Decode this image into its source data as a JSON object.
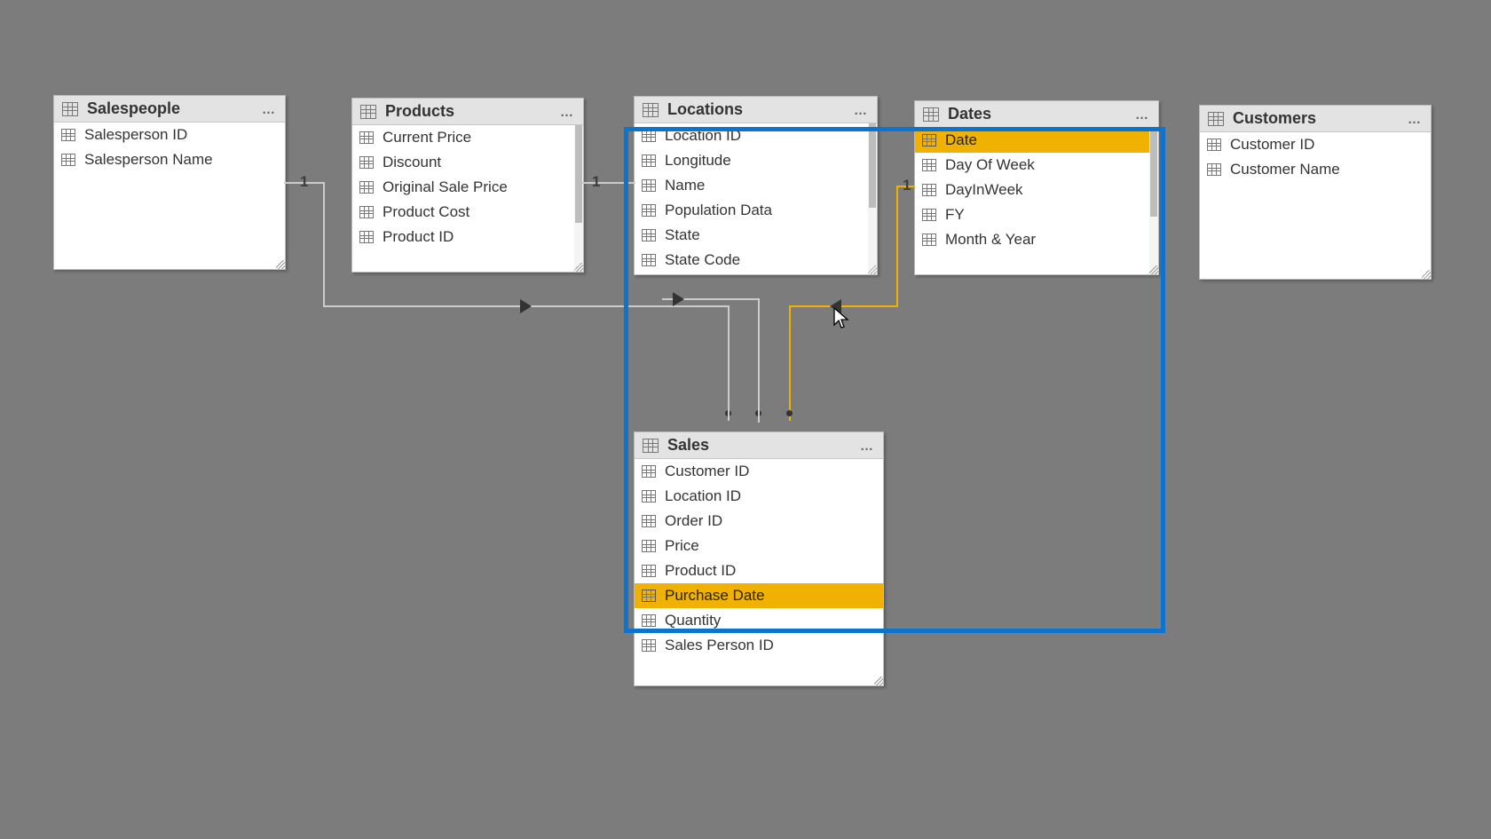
{
  "tables": {
    "salespeople": {
      "title": "Salespeople",
      "fields": [
        "Salesperson ID",
        "Salesperson Name"
      ]
    },
    "products": {
      "title": "Products",
      "fields": [
        "Current Price",
        "Discount",
        "Original Sale Price",
        "Product Cost",
        "Product ID"
      ]
    },
    "locations": {
      "title": "Locations",
      "fields": [
        "Location ID",
        "Longitude",
        "Name",
        "Population Data",
        "State",
        "State Code"
      ]
    },
    "dates": {
      "title": "Dates",
      "fields": [
        "Date",
        "Day Of Week",
        "DayInWeek",
        "FY",
        "Month & Year"
      ]
    },
    "customers": {
      "title": "Customers",
      "fields": [
        "Customer ID",
        "Customer Name"
      ]
    },
    "sales": {
      "title": "Sales",
      "fields": [
        "Customer ID",
        "Location ID",
        "Order ID",
        "Price",
        "Product ID",
        "Purchase Date",
        "Quantity",
        "Sales Person ID"
      ]
    }
  },
  "cardinality": {
    "one": "1",
    "many": "*"
  },
  "highlight": {
    "from_table": "Dates",
    "from_field": "Date",
    "to_table": "Sales",
    "to_field": "Purchase Date"
  }
}
